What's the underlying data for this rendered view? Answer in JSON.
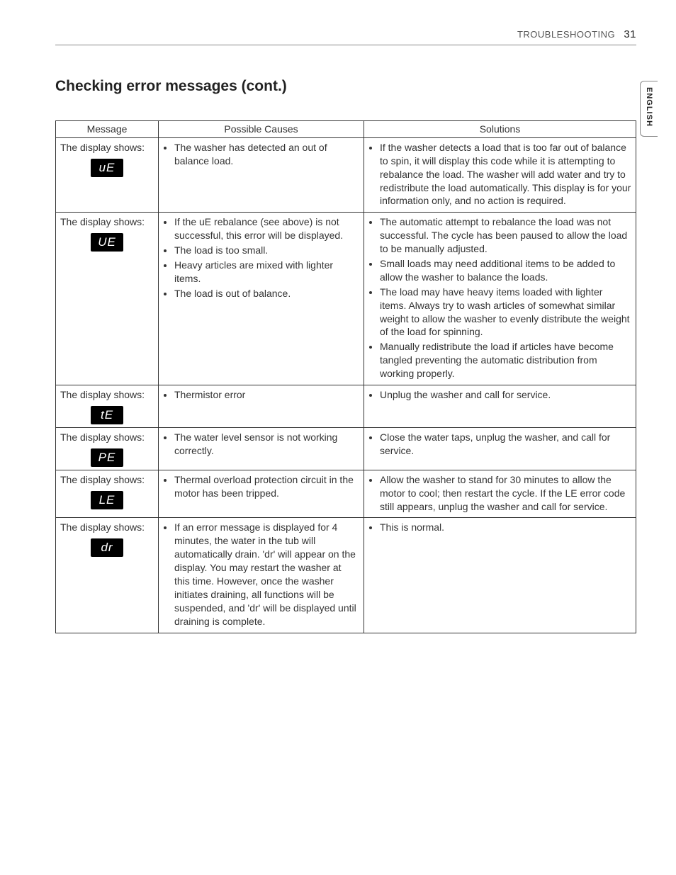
{
  "header": {
    "section": "Troubleshooting",
    "page_number": "31"
  },
  "language_tab": "ENGLISH",
  "title": "Checking error messages (cont.)",
  "table": {
    "headers": {
      "message": "Message",
      "causes": "Possible Causes",
      "solutions": "Solutions"
    },
    "rows": [
      {
        "msg_intro": "The display shows:",
        "code": "uE",
        "causes": [
          "The washer has detected an out of balance load."
        ],
        "solutions": [
          "If the washer detects a load that is too far out of balance to spin, it will display this code while it is attempting to rebalance the load. The washer will add water and try to redistribute the load automatically. This display is for your information only, and no action is required."
        ]
      },
      {
        "msg_intro": "The display shows:",
        "code": "UE",
        "causes": [
          "If the uE rebalance (see above) is not successful, this error will be displayed.",
          "The load is too small.",
          "Heavy articles are mixed with lighter items.",
          "The load is out of balance."
        ],
        "solutions": [
          "The automatic attempt to rebalance the load was not successful. The cycle has been paused to allow the load to be manually adjusted.",
          "Small loads may need additional items to be added to allow the washer to balance the loads.",
          "The load may have heavy items loaded with lighter items. Always try to wash articles of somewhat similar weight to allow the washer to evenly distribute the weight of the load for spinning.",
          "Manually redistribute the load if articles have become tangled preventing the automatic distribution from working properly."
        ]
      },
      {
        "msg_intro": "The display shows:",
        "code": "tE",
        "causes": [
          "Thermistor error"
        ],
        "solutions": [
          "Unplug the washer and call for service."
        ]
      },
      {
        "msg_intro": "The display shows:",
        "code": "PE",
        "causes": [
          "The water level sensor is not working correctly."
        ],
        "solutions": [
          "Close the water taps, unplug the washer, and call for service."
        ]
      },
      {
        "msg_intro": "The display shows:",
        "code": "LE",
        "causes": [
          "Thermal overload protection circuit in the motor has been tripped."
        ],
        "solutions": [
          "Allow the washer to stand for 30 minutes to allow the motor to cool; then restart the cycle. If the LE error code still appears, unplug the washer and call for service."
        ]
      },
      {
        "msg_intro": "The display shows:",
        "code": "dr",
        "causes": [
          "If an error message is displayed for 4 minutes, the water in the tub will automatically drain. 'dr' will appear on the display. You may restart the washer at this time. However, once the washer initiates draining, all functions will be suspended, and 'dr' will be displayed until draining is complete."
        ],
        "solutions": [
          "This is normal."
        ]
      }
    ]
  }
}
